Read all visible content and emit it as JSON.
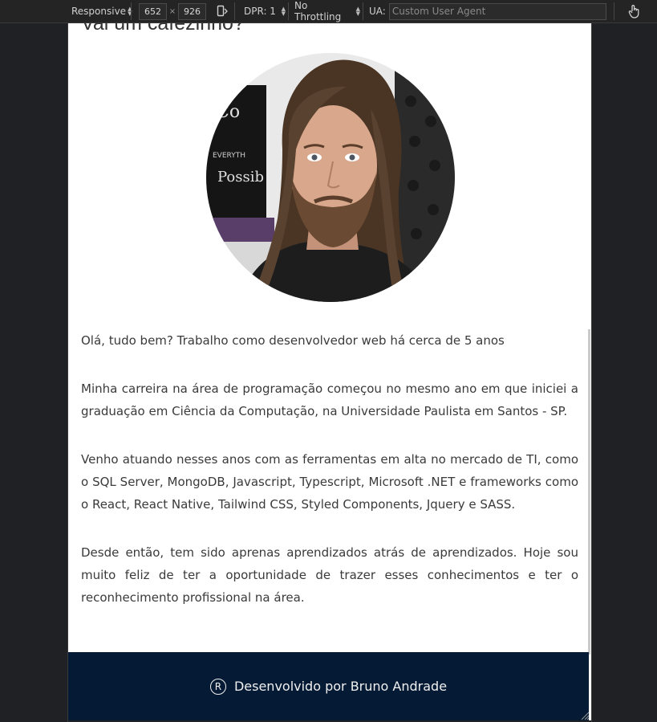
{
  "devtools": {
    "device": "Responsive",
    "width": "652",
    "height": "926",
    "times": "×",
    "dpr": "DPR: 1",
    "throttling": "No Throttling",
    "ua_label": "UA:",
    "ua_placeholder": "Custom User Agent"
  },
  "page": {
    "partial_title": "Vai um cafezinho?",
    "avatar_alt": "Bruno Andrade",
    "paragraphs": [
      "Olá, tudo bem? Trabalho como desenvolvedor web há cerca de 5 anos",
      "Minha carreira na área de programação começou no mesmo ano em que iniciei a graduação em Ciência da Computação, na Universidade Paulista em Santos - SP.",
      "Venho atuando nesses anos com as ferramentas em alta no mercado de TI, como o SQL Server, MongoDB, Javascript, Typescript, Microsoft .NET e frameworks como o React, React Native, Tailwind CSS, Styled Components, Jquery e SASS.",
      "Desde então, tem sido aprenas aprendizados atrás de aprendizados. Hoje sou muito feliz de ter a oportunidade de trazer esses conhecimentos e ter o reconhecimento profissional na área."
    ],
    "footer_text": "Desenvolvido por Bruno Andrade",
    "footer_symbol": "R"
  },
  "colors": {
    "footer_bg": "#051a34",
    "toolbar_bg": "#242424",
    "page_bg": "#ffffff"
  },
  "icons": [
    "rotate-device-icon",
    "touch-hand-icon",
    "registered-icon",
    "resize-grip-icon"
  ]
}
